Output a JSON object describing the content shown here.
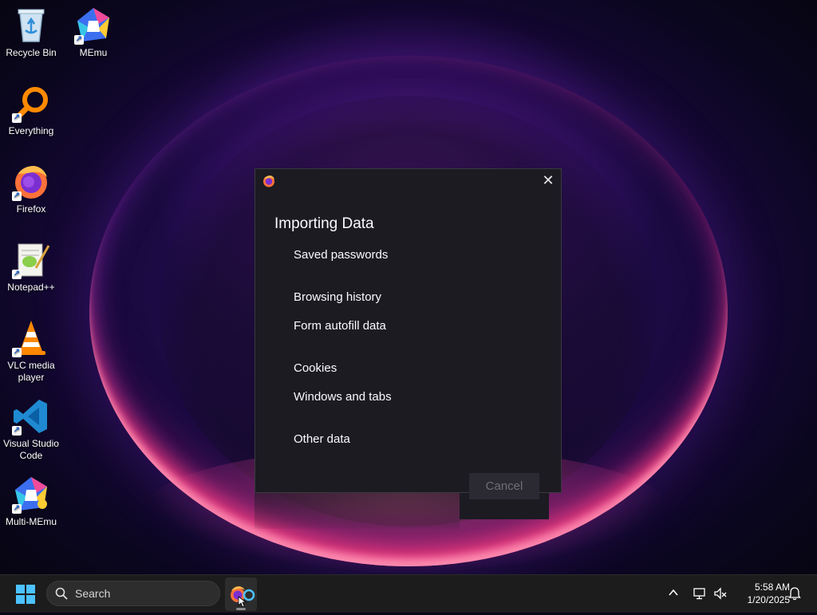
{
  "desktop": {
    "icons": [
      {
        "label": "Recycle Bin",
        "icon": "recycle-bin-icon"
      },
      {
        "label": "MEmu",
        "icon": "memu-icon"
      },
      {
        "label": "Everything",
        "icon": "everything-search-icon"
      },
      {
        "label": "Firefox",
        "icon": "firefox-icon"
      },
      {
        "label": "Notepad++",
        "icon": "notepad-plus-plus-icon"
      },
      {
        "label": "VLC media player",
        "icon": "vlc-cone-icon"
      },
      {
        "label": "Visual Studio Code",
        "icon": "vscode-icon"
      },
      {
        "label": "Multi-MEmu",
        "icon": "multi-memu-icon"
      }
    ]
  },
  "dialog": {
    "title": "Importing Data",
    "items": [
      "Saved passwords",
      "Browsing history",
      "Form autofill data",
      "Cookies",
      "Windows and tabs",
      "Other data"
    ],
    "cancel_label": "Cancel",
    "close_icon": "close-icon",
    "app_icon": "firefox-icon"
  },
  "taskbar": {
    "search_label": "Search",
    "time": "5:58 AM",
    "date": "1/20/2025",
    "tray_icons": [
      "chevron-up-icon",
      "network-icon",
      "speaker-muted-icon",
      "notification-bell-icon"
    ]
  },
  "colors": {
    "dialog_bg": "#1c1b22",
    "taskbar_bg": "#1c1c1c",
    "accent": "#4cc2ff"
  }
}
